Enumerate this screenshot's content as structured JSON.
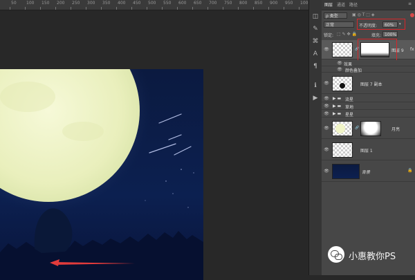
{
  "ruler": {
    "ticks": [
      "50",
      "100",
      "150",
      "200",
      "250",
      "300",
      "350",
      "400",
      "450",
      "500",
      "550",
      "600",
      "650",
      "700",
      "750",
      "800",
      "850",
      "900",
      "950",
      "1000",
      "1050"
    ]
  },
  "panel": {
    "tabs": [
      "图层",
      "通道",
      "路径"
    ],
    "filter_kind": "ρ 类型",
    "blend_mode": "正常",
    "opacity_label": "不透明度:",
    "opacity_value": "60%",
    "lock_label": "锁定:",
    "fill_label": "填充:",
    "fill_value": "100%"
  },
  "layers": {
    "top_layer_name": "图层 9",
    "effects_label": "效果",
    "color_overlay_label": "颜色叠加",
    "layer7_copy": "图层 7 副本",
    "group_flow": "流星",
    "group_grass": "草地",
    "group_stars": "星星",
    "moon_layer": "月亮",
    "layer1": "图层 1",
    "background": "背景"
  },
  "watermark": {
    "text": "小惠教你PS"
  },
  "colors": {
    "highlight": "#d8262a",
    "moon": "#f1f5c8",
    "sky": "#0c2050"
  }
}
